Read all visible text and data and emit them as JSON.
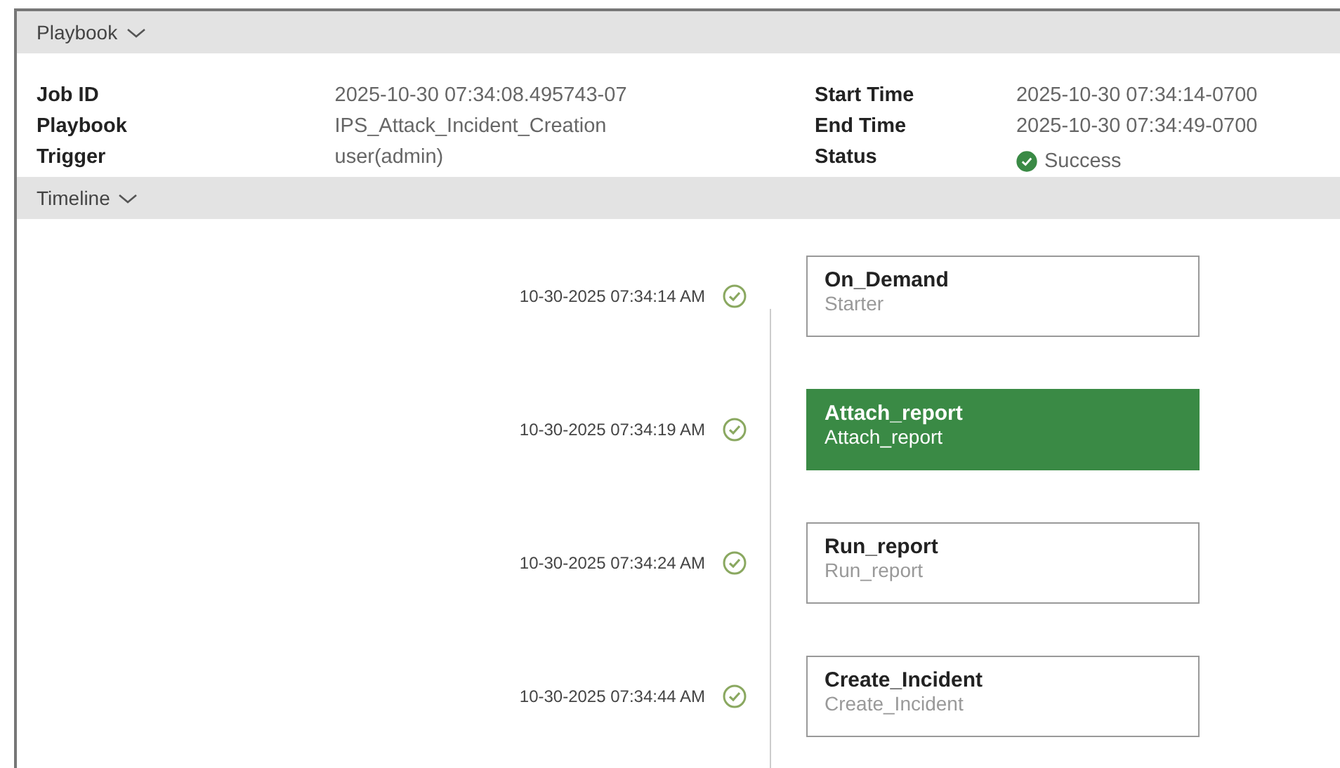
{
  "sections": [
    {
      "title": "Playbook",
      "expanded": true
    },
    {
      "title": "Timeline",
      "expanded": true
    }
  ],
  "details_left": [
    {
      "label": "Job ID",
      "value": "2025-10-30 07:34:08.495743-07"
    },
    {
      "label": "Playbook",
      "value": "IPS_Attack_Incident_Creation"
    },
    {
      "label": "Trigger",
      "value": "user(admin)"
    }
  ],
  "details_right": [
    {
      "label": "Start Time",
      "value": "2025-10-30 07:34:14-0700",
      "kind": "text"
    },
    {
      "label": "End Time",
      "value": "2025-10-30 07:34:49-0700",
      "kind": "text"
    },
    {
      "label": "Status",
      "value": "Success",
      "kind": "status"
    }
  ],
  "timeline": [
    {
      "time": "10-30-2025 07:34:14 AM",
      "name": "On_Demand",
      "subtitle": "Starter",
      "selected": false
    },
    {
      "time": "10-30-2025 07:34:19 AM",
      "name": "Attach_report",
      "subtitle": "Attach_report",
      "selected": true
    },
    {
      "time": "10-30-2025 07:34:24 AM",
      "name": "Run_report",
      "subtitle": "Run_report",
      "selected": false
    },
    {
      "time": "10-30-2025 07:34:44 AM",
      "name": "Create_Incident",
      "subtitle": "Create_Incident",
      "selected": false
    }
  ]
}
